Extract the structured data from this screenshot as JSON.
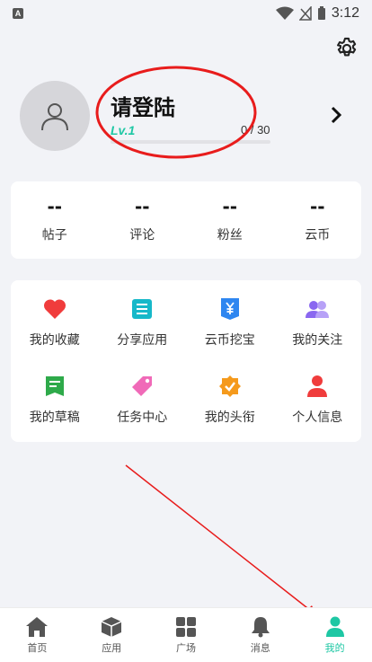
{
  "status_bar": {
    "time": "3:12",
    "notification_letter": "A"
  },
  "profile": {
    "username": "请登陆",
    "level": "Lv.1",
    "progress_text": "0 / 30",
    "progress_fraction": 0
  },
  "stats": [
    {
      "value": "--",
      "label": "帖子"
    },
    {
      "value": "--",
      "label": "评论"
    },
    {
      "value": "--",
      "label": "粉丝"
    },
    {
      "value": "--",
      "label": "云币"
    }
  ],
  "grid": [
    {
      "label": "我的收藏",
      "icon": "heart-icon",
      "color": "#f03c3c"
    },
    {
      "label": "分享应用",
      "icon": "list-icon",
      "color": "#16b8c9"
    },
    {
      "label": "云币挖宝",
      "icon": "yen-icon",
      "color": "#2e86f0"
    },
    {
      "label": "我的关注",
      "icon": "people-icon",
      "color": "#8a67f0"
    },
    {
      "label": "我的草稿",
      "icon": "draft-icon",
      "color": "#2eaa4a"
    },
    {
      "label": "任务中心",
      "icon": "tag-icon",
      "color": "#f06ab8"
    },
    {
      "label": "我的头衔",
      "icon": "badge-icon",
      "color": "#f59a1c"
    },
    {
      "label": "个人信息",
      "icon": "person-icon",
      "color": "#f03c3c"
    }
  ],
  "tabs": [
    {
      "label": "首页",
      "icon": "home-icon"
    },
    {
      "label": "应用",
      "icon": "box-icon"
    },
    {
      "label": "广场",
      "icon": "grid-icon"
    },
    {
      "label": "消息",
      "icon": "bell-icon"
    },
    {
      "label": "我的",
      "icon": "user-icon",
      "active": true
    }
  ],
  "colors": {
    "accent": "#1ec7a4",
    "annotation": "#e81c1c",
    "background": "#f2f3f7"
  }
}
